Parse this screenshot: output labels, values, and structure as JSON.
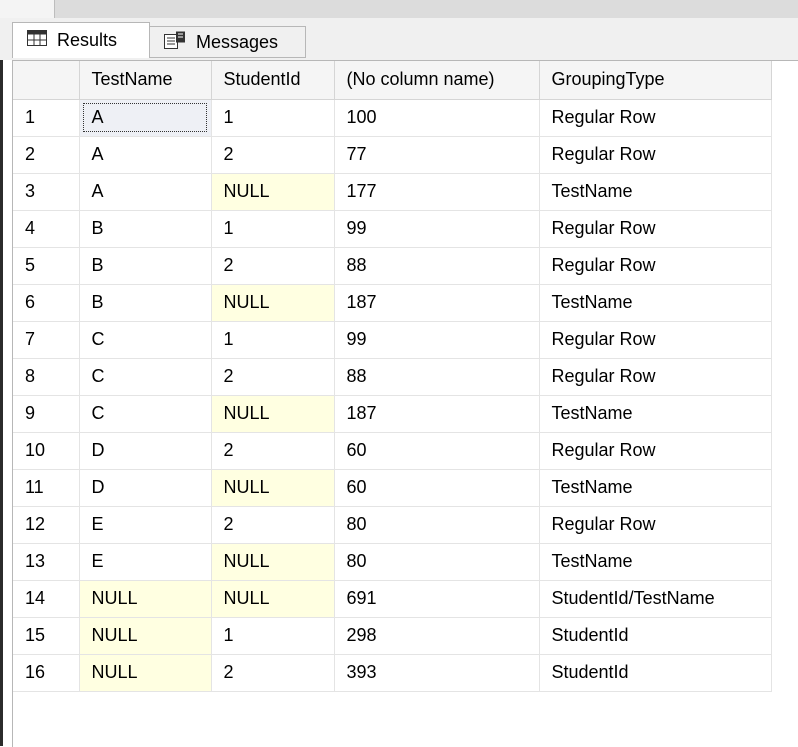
{
  "tabs": {
    "results_label": "Results",
    "messages_label": "Messages"
  },
  "grid": {
    "columns": [
      "",
      "TestName",
      "StudentId",
      "(No column name)",
      "GroupingType"
    ],
    "rows": [
      [
        "1",
        "A",
        "1",
        "100",
        "Regular Row"
      ],
      [
        "2",
        "A",
        "2",
        "77",
        "Regular Row"
      ],
      [
        "3",
        "A",
        "NULL",
        "177",
        "TestName"
      ],
      [
        "4",
        "B",
        "1",
        "99",
        "Regular Row"
      ],
      [
        "5",
        "B",
        "2",
        "88",
        "Regular Row"
      ],
      [
        "6",
        "B",
        "NULL",
        "187",
        "TestName"
      ],
      [
        "7",
        "C",
        "1",
        "99",
        "Regular Row"
      ],
      [
        "8",
        "C",
        "2",
        "88",
        "Regular Row"
      ],
      [
        "9",
        "C",
        "NULL",
        "187",
        "TestName"
      ],
      [
        "10",
        "D",
        "2",
        "60",
        "Regular Row"
      ],
      [
        "11",
        "D",
        "NULL",
        "60",
        "TestName"
      ],
      [
        "12",
        "E",
        "2",
        "80",
        "Regular Row"
      ],
      [
        "13",
        "E",
        "NULL",
        "80",
        "TestName"
      ],
      [
        "14",
        "NULL",
        "NULL",
        "691",
        "StudentId/TestName"
      ],
      [
        "15",
        "NULL",
        "1",
        "298",
        "StudentId"
      ],
      [
        "16",
        "NULL",
        "2",
        "393",
        "StudentId"
      ]
    ],
    "selected_cell": "row 1, TestName",
    "null_highlight_color": "#ffffe1"
  },
  "icons": {
    "results": "grid-icon",
    "messages": "messages-icon"
  }
}
